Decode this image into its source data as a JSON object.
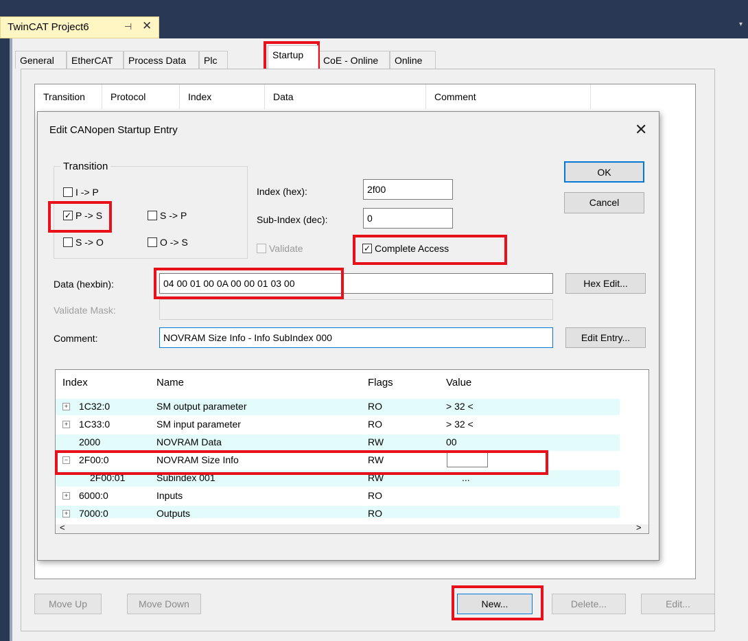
{
  "document_tab": {
    "title": "TwinCAT Project6",
    "pin_glyph": "⊣",
    "close_glyph": "✕"
  },
  "tabs": [
    "General",
    "EtherCAT",
    "Process Data",
    "Plc",
    "Startup",
    "CoE - Online",
    "Online"
  ],
  "active_tab": "Startup",
  "startup_list": {
    "columns": [
      "Transition",
      "Protocol",
      "Index",
      "Data",
      "Comment"
    ]
  },
  "bottom_buttons": {
    "move_up": "Move Up",
    "move_down": "Move Down",
    "new": "New...",
    "delete": "Delete...",
    "edit": "Edit..."
  },
  "dialog": {
    "title": "Edit CANopen Startup Entry",
    "close_glyph": "✕",
    "transition_group": "Transition",
    "transitions": [
      {
        "label": "I -> P",
        "checked": false
      },
      {
        "label": "P -> S",
        "checked": true
      },
      {
        "label": "S -> P",
        "checked": false
      },
      {
        "label": "S -> O",
        "checked": false
      },
      {
        "label": "O -> S",
        "checked": false
      }
    ],
    "index_label": "Index (hex):",
    "index_value": "2f00",
    "subindex_label": "Sub-Index (dec):",
    "subindex_value": "0",
    "validate_label": "Validate",
    "complete_access_label": "Complete Access",
    "ok": "OK",
    "cancel": "Cancel",
    "data_label": "Data (hexbin):",
    "data_value": "04 00 01 00 0A 00 00 01 03 00",
    "validate_mask_label": "Validate Mask:",
    "validate_mask_value": "",
    "comment_label": "Comment:",
    "comment_value": "NOVRAM Size Info - Info SubIndex 000",
    "hex_edit": "Hex Edit...",
    "edit_entry": "Edit Entry...",
    "tree_columns": [
      "Index",
      "Name",
      "Flags",
      "Value"
    ],
    "tree_rows": [
      {
        "expander": "+",
        "index": "1C32:0",
        "name": "SM output parameter",
        "flags": "RO",
        "value": "> 32 <"
      },
      {
        "expander": "+",
        "index": "1C33:0",
        "name": "SM input parameter",
        "flags": "RO",
        "value": "> 32 <"
      },
      {
        "expander": "",
        "index": "2000",
        "name": "NOVRAM Data",
        "flags": "RW",
        "value": "00"
      },
      {
        "expander": "−",
        "index": "2F00:0",
        "name": "NOVRAM Size Info",
        "flags": "RW",
        "value": ""
      },
      {
        "expander": "",
        "index": "2F00:01",
        "name": "Subindex 001",
        "flags": "RW",
        "value": "..."
      },
      {
        "expander": "+",
        "index": "6000:0",
        "name": "Inputs",
        "flags": "RO",
        "value": ""
      },
      {
        "expander": "+",
        "index": "7000:0",
        "name": "Outputs",
        "flags": "RO",
        "value": ""
      }
    ],
    "scroll_left": "<",
    "scroll_right": ">"
  },
  "colors": {
    "highlight": "#e8101a",
    "doc_tab_bg": "#fff6c4",
    "ide_bg": "#293955",
    "row_tint": "#e3fbfb"
  }
}
